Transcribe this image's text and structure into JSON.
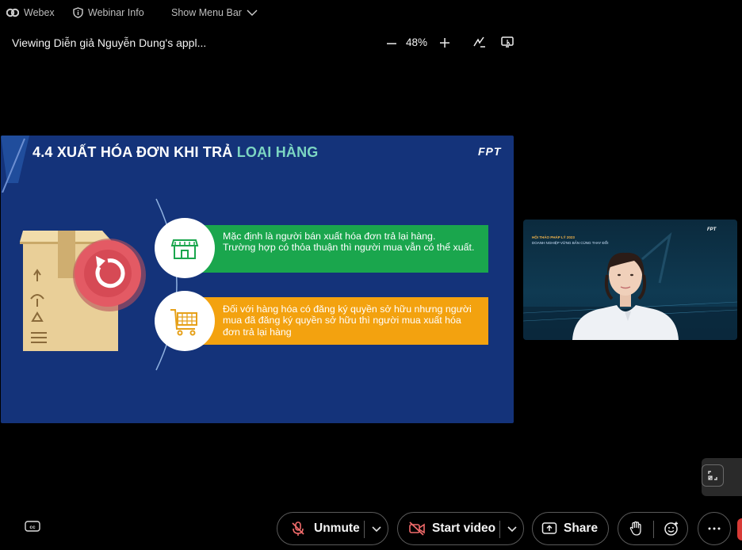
{
  "menubar": {
    "app_name": "Webex",
    "webinar_info": "Webinar Info",
    "show_menu_bar": "Show Menu Bar"
  },
  "share_header": {
    "title": "Viewing Diễn giả Nguyễn Dung's appl...",
    "zoom_level": "48%"
  },
  "slide": {
    "title_prefix": "4.4 XUẤT HÓA ĐƠN KHI TRẢ ",
    "title_highlight": "LOẠI HÀNG",
    "logo": "FPT",
    "item1_line1": "Mặc định là người bán xuất hóa đơn trả lại hàng.",
    "item1_line2": "Trường hợp có thỏa thuận thì người mua vẫn có thể xuất.",
    "item2_text": "Đối với hàng hóa có đăng ký quyền sở hữu nhưng người mua đã đăng ký quyền sở hữu thì người mua xuất hóa đơn trả lại hàng"
  },
  "video": {
    "banner_line": "HỘI THẢO PHÁP LÝ 2023",
    "banner_sub": "DOANH NGHIỆP VỮNG BẢN CÙNG THAY ĐỔI",
    "logo": "FPT"
  },
  "controls": {
    "unmute_label": "Unmute",
    "start_video_label": "Start video",
    "share_label": "Share"
  },
  "colors": {
    "slide_bg": "#14337a",
    "green_band": "#1aa64d",
    "orange_band": "#f3a20f",
    "title_highlight": "#7cd6c2"
  },
  "icons": [
    "webex-logo-icon",
    "shield-info-icon",
    "chevron-down-icon",
    "zoom-out-icon",
    "zoom-in-icon",
    "annotate-icon",
    "remote-control-icon",
    "store-icon",
    "cart-icon",
    "return-icon",
    "expand-icon",
    "closed-caption-icon",
    "mic-off-icon",
    "video-off-icon",
    "share-icon",
    "raise-hand-icon",
    "reactions-icon",
    "more-icon"
  ]
}
